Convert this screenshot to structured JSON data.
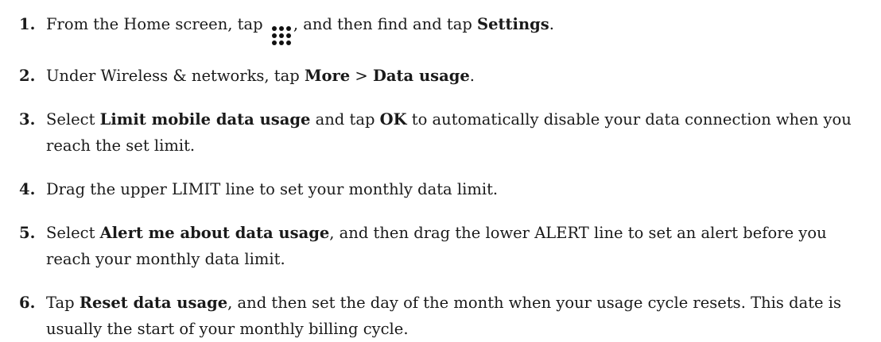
{
  "steps": [
    {
      "number": "1",
      "parts": {
        "t1": "From the Home screen, tap",
        "icon": "apps-grid-icon",
        "t2": ", and then find and tap",
        "b1": "Settings",
        "t3": "."
      }
    },
    {
      "number": "2",
      "parts": {
        "t1": "Under Wireless & networks, tap",
        "b1": "More",
        "t2": ">",
        "b2": "Data usage",
        "t3": "."
      }
    },
    {
      "number": "3",
      "parts": {
        "t1": "Select",
        "b1": "Limit mobile data usage",
        "t2": "and tap",
        "b2": "OK",
        "t3": "to automatically disable your data connection when you reach the set limit."
      }
    },
    {
      "number": "4",
      "parts": {
        "t1": "Drag the upper LIMIT line to set your monthly data limit."
      }
    },
    {
      "number": "5",
      "parts": {
        "t1": "Select",
        "b1": "Alert me about data usage",
        "t2": ", and then drag the lower ALERT line to set an alert before you reach your monthly data limit."
      }
    },
    {
      "number": "6",
      "parts": {
        "t1": "Tap",
        "b1": "Reset data usage",
        "t2": ", and then set the day of the month when your usage cycle resets. This date is usually the start of your monthly billing cycle."
      }
    }
  ]
}
